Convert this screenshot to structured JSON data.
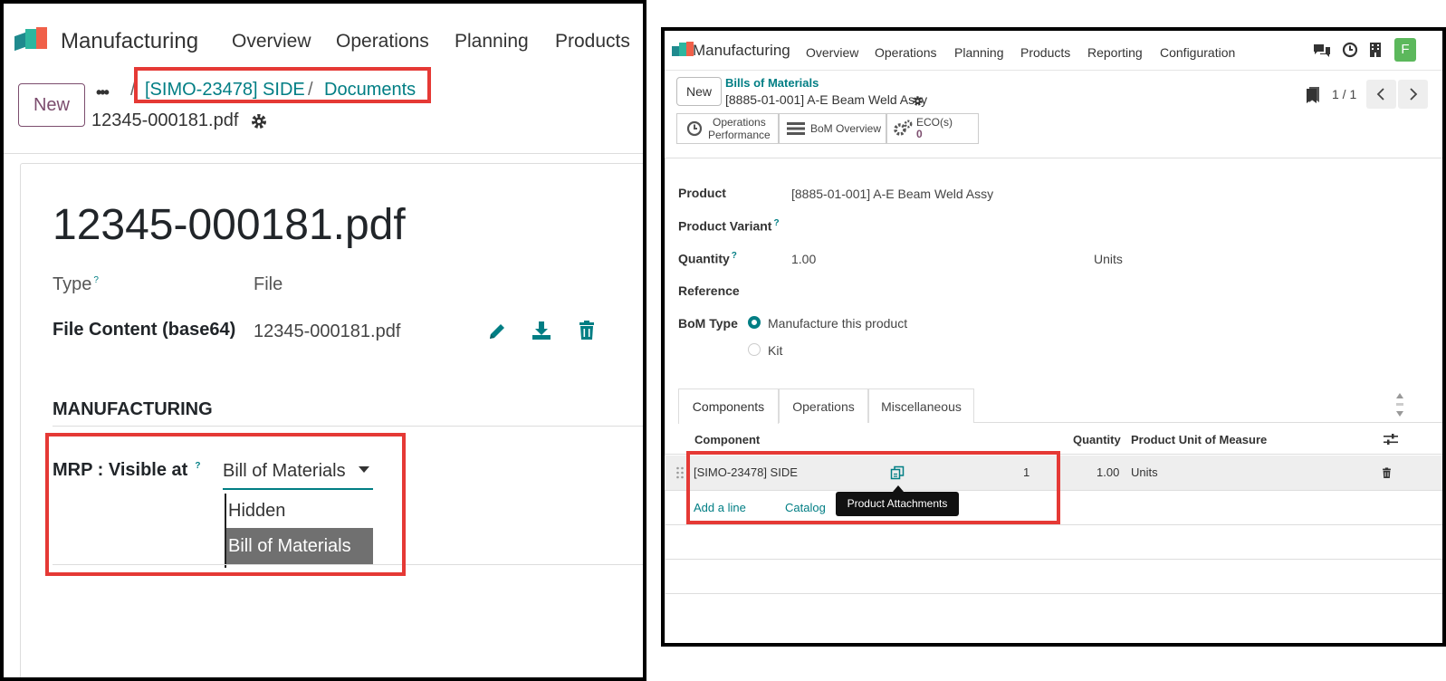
{
  "left": {
    "app_name": "Manufacturing",
    "menu": [
      "Overview",
      "Operations",
      "Planning",
      "Products"
    ],
    "new_label": "New",
    "ellipsis": "•••",
    "breadcrumb": {
      "parent": "[SIMO-23478] SIDE",
      "separator": "/",
      "current": "Documents"
    },
    "record_name": "12345-000181.pdf",
    "title": "12345-000181.pdf",
    "type_label": "Type",
    "type_help": "?",
    "type_value": "File",
    "file_content_label": "File Content (base64)",
    "file_name": "12345-000181.pdf",
    "section_title": "MANUFACTURING",
    "mrp_label": "MRP : Visible at",
    "mrp_help": "?",
    "mrp_value": "Bill of Materials",
    "mrp_options": [
      "Hidden",
      "Bill of Materials"
    ]
  },
  "right": {
    "app_name": "Manufacturing",
    "menu": [
      "Overview",
      "Operations",
      "Planning",
      "Products",
      "Reporting",
      "Configuration"
    ],
    "avatar_letter": "F",
    "new_label": "New",
    "breadcrumb_parent": "Bills of Materials",
    "record_name": "[8885-01-001] A-E Beam Weld Assy",
    "pager": "1 / 1",
    "smart_buttons": {
      "ops_perf_line1": "Operations",
      "ops_perf_line2": "Performance",
      "bom_overview": "BoM Overview",
      "eco_label": "ECO(s)",
      "eco_count": "0"
    },
    "fields": {
      "product_label": "Product",
      "product_value": "[8885-01-001] A-E Beam Weld Assy",
      "variant_label": "Product Variant",
      "quantity_label": "Quantity",
      "quantity_value": "1.00",
      "quantity_uom": "Units",
      "reference_label": "Reference",
      "bom_type_label": "BoM Type",
      "bom_type_options": [
        "Manufacture this product",
        "Kit"
      ],
      "help": "?"
    },
    "tabs": [
      "Components",
      "Operations",
      "Miscellaneous"
    ],
    "table": {
      "headers": {
        "component": "Component",
        "quantity": "Quantity",
        "uom": "Product Unit of Measure"
      },
      "row": {
        "component": "[SIMO-23478] SIDE",
        "attachments_count": "1",
        "quantity": "1.00",
        "uom": "Units"
      },
      "add_line": "Add a line",
      "catalog": "Catalog",
      "tooltip": "Product Attachments"
    }
  },
  "colors": {
    "accent_teal": "#017e84",
    "brand_purple": "#7c4d6e",
    "highlight_red": "#e53935",
    "avatar_green": "#5cb85c"
  }
}
